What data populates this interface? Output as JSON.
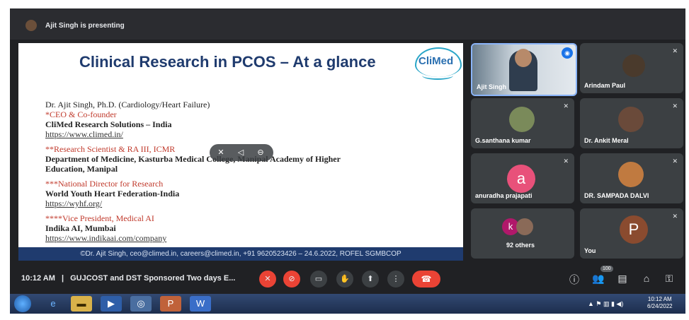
{
  "presenter_bar": {
    "text": "Ajit Singh is presenting"
  },
  "slide": {
    "title": "Clinical Research in PCOS – At a glance",
    "logo_text": "CliMed",
    "lines": [
      {
        "text": "Dr. Ajit Singh, Ph.D. (Cardiology/Heart Failure)",
        "style": "normal"
      },
      {
        "text": "*CEO & Co-founder",
        "style": "red"
      },
      {
        "text": "CliMed Research Solutions – India",
        "style": "normal"
      },
      {
        "text": "https://www.climed.in/",
        "style": "link"
      },
      {
        "text": "**Research Scientist & RA III, ICMR",
        "style": "red"
      },
      {
        "text": "Department of Medicine, Kasturba Medical College, Manipal Academy of Higher",
        "style": "bold"
      },
      {
        "text": "Education, Manipal",
        "style": "bold"
      },
      {
        "text": "***National Director for Research",
        "style": "red"
      },
      {
        "text": "World Youth Heart Federation-India",
        "style": "bold"
      },
      {
        "text": "https://wyhf.org/",
        "style": "link"
      },
      {
        "text": "****Vice President, Medical AI",
        "style": "red"
      },
      {
        "text": "Indika AI, Mumbai",
        "style": "bold"
      },
      {
        "text": "https://www.indikaai.com/company",
        "style": "link"
      }
    ],
    "footer": "©Dr. Ajit Singh, ceo@climed.in, careers@climed.in, +91 9620523426 – 24.6.2022, ROFEL SGMBCOP"
  },
  "participants": [
    {
      "name": "Ajit Singh",
      "kind": "active"
    },
    {
      "name": "Arindam Paul",
      "kind": "photo"
    },
    {
      "name": "G.santhana kumar",
      "kind": "photo"
    },
    {
      "name": "Dr. Ankit Meral",
      "kind": "photo"
    },
    {
      "name": "anuradha prajapati",
      "kind": "letter",
      "letter": "a",
      "color": "#e8517a"
    },
    {
      "name": "DR. SAMPADA DALVI",
      "kind": "photo"
    },
    {
      "name": "92 others",
      "kind": "others",
      "letter": "k"
    },
    {
      "name": "You",
      "kind": "letter",
      "letter": "P",
      "color": "#8a4b2f"
    }
  ],
  "bottom_bar": {
    "time": "10:12 AM",
    "separator": "|",
    "meeting_title": "GUJCOST and DST Sponsored Two days E...",
    "participant_count_badge": "100"
  },
  "taskbar": {
    "clock_time": "10:12 AM",
    "clock_date": "6/24/2022"
  },
  "colors": {
    "accent_red": "#ea4335",
    "slide_title": "#1f3b6e",
    "footer_strip": "#1f3b6e"
  }
}
